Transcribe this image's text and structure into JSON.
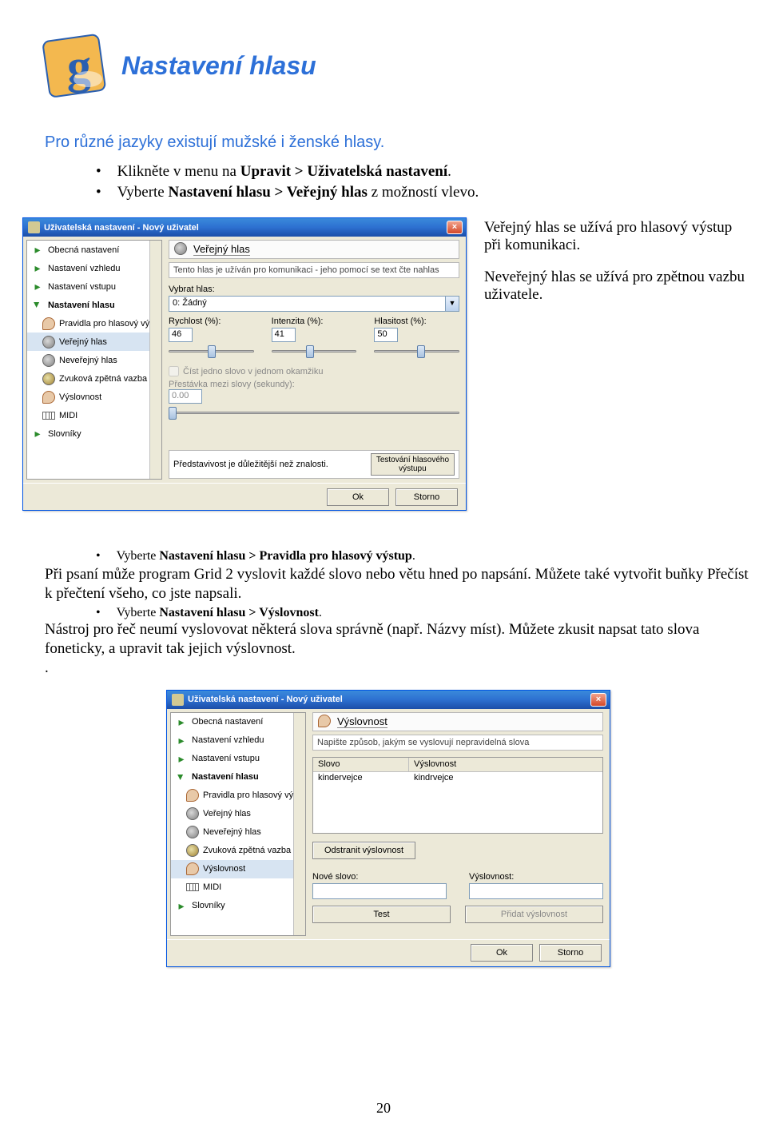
{
  "heading": "Nastavení hlasu",
  "intro": "Pro různé jazyky existují mužské i ženské hlasy.",
  "bullets_top": [
    {
      "pre": "Klikněte v menu na ",
      "bold": "Upravit > Uživatelská nastavení",
      "post": "."
    },
    {
      "pre": "Vyberte ",
      "bold": "Nastavení hlasu > Veřejný hlas",
      "post": " z možností vlevo."
    }
  ],
  "side_text": {
    "p1": "Veřejný hlas se užívá pro hlasový výstup při komunikaci.",
    "p2": "Neveřejný hlas se užívá pro zpětnou vazbu uživatele."
  },
  "dlg1": {
    "title": "Uživatelská nastavení - Nový uživatel",
    "tree": [
      "Obecná nastavení",
      "Nastavení vzhledu",
      "Nastavení vstupu",
      "Nastavení hlasu",
      "Pravidla pro hlasový výstup",
      "Veřejný hlas",
      "Neveřejný hlas",
      "Zvuková zpětná vazba",
      "Výslovnost",
      "MIDI",
      "Slovníky"
    ],
    "panel_title": "Veřejný hlas",
    "panel_desc": "Tento hlas je užíván pro komunikaci - jeho pomocí se text čte nahlas",
    "select_label": "Vybrat hlas:",
    "select_value": "0: Žádný",
    "sliders": {
      "rate": {
        "label": "Rychlost (%):",
        "val": "46",
        "pos": 46
      },
      "intensity": {
        "label": "Intenzita (%):",
        "val": "41",
        "pos": 41
      },
      "volume": {
        "label": "Hlasitost (%):",
        "val": "50",
        "pos": 50
      }
    },
    "chk_label": "Číst jedno slovo v jednom okamžiku",
    "pause_label": "Přestávka mezi slovy (sekundy):",
    "pause_val": "0.00",
    "quote": "Představivost je důležitější než znalosti.",
    "test_btn": "Testování hlasového\nvýstupu",
    "ok": "Ok",
    "cancel": "Storno"
  },
  "mid_bullet": {
    "pre": "Vyberte ",
    "bold": "Nastavení hlasu > Pravidla pro hlasový výstup",
    "post": "."
  },
  "para1": "Při psaní může program Grid 2 vyslovit každé slovo nebo větu hned po napsání. Můžete také vytvořit buňky Přečíst k přečtení všeho, co jste napsali.",
  "mid_bullet2": {
    "pre": "Vyberte ",
    "bold": "Nastavení hlasu > Výslovnost",
    "post": "."
  },
  "para2": "Nástroj pro řeč  neumí vyslovovat některá slova správně (např. Názvy míst). Můžete zkusit napsat tato slova foneticky, a upravit tak jejich výslovnost.",
  "dot": ".",
  "dlg2": {
    "title": "Uživatelská nastavení - Nový uživatel",
    "panel_title": "Výslovnost",
    "panel_desc": "Napište způsob, jakým se vyslovují nepravidelná slova",
    "col1": "Slovo",
    "col2": "Výslovnost",
    "row_word": "kindervejce",
    "row_pron": "kindrvejce",
    "remove_btn": "Odstranit výslovnost",
    "new_word_lbl": "Nové slovo:",
    "pron_lbl": "Výslovnost:",
    "test_btn": "Test",
    "add_btn": "Přidat výslovnost",
    "ok": "Ok",
    "cancel": "Storno"
  },
  "page_num": "20"
}
